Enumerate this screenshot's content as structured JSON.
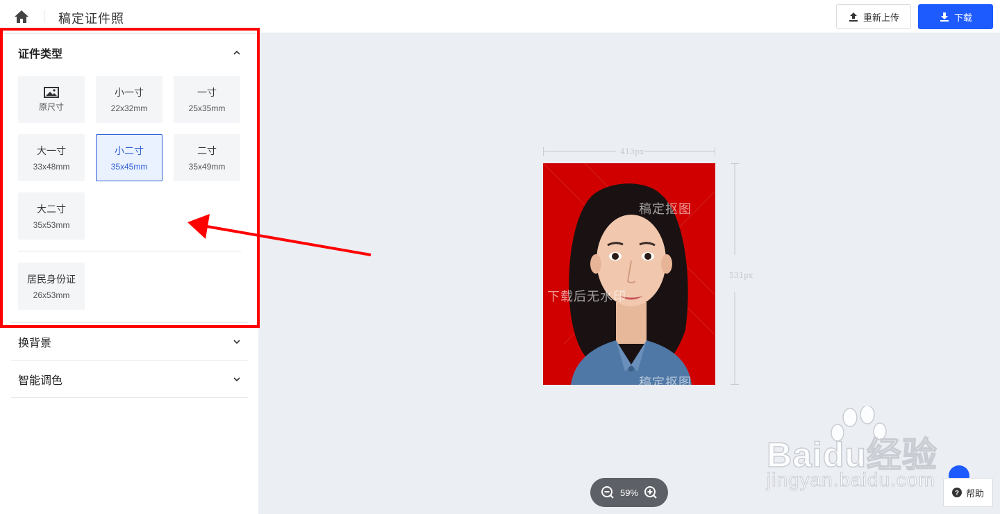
{
  "header": {
    "title": "稿定证件照",
    "reupload_label": "重新上传",
    "download_label": "下载"
  },
  "sidebar": {
    "section_id_type": "证件类型",
    "tiles": [
      {
        "name": "",
        "size": "原尺寸"
      },
      {
        "name": "小一寸",
        "size": "22x32mm"
      },
      {
        "name": "一寸",
        "size": "25x35mm"
      },
      {
        "name": "大一寸",
        "size": "33x48mm"
      },
      {
        "name": "小二寸",
        "size": "35x45mm"
      },
      {
        "name": "二寸",
        "size": "35x49mm"
      },
      {
        "name": "大二寸",
        "size": "35x53mm"
      },
      {
        "name": "居民身份证",
        "size": "26x53mm"
      }
    ],
    "selected_tile": "小二寸",
    "section_background": "换背景",
    "section_color": "智能调色"
  },
  "preview": {
    "width_label": "413px",
    "height_label": "531px",
    "watermark_1": "稿定抠图",
    "watermark_2": "下载后无水印",
    "watermark_3": "稿定抠图",
    "background_color": "#d00000"
  },
  "zoom": {
    "level": "59%"
  },
  "help": {
    "label": "帮助"
  },
  "overlay": {
    "baidu_logo": "Baidu经验",
    "baidu_url": "jingyan.baidu.com",
    "highlight_color": "#ff0000"
  }
}
